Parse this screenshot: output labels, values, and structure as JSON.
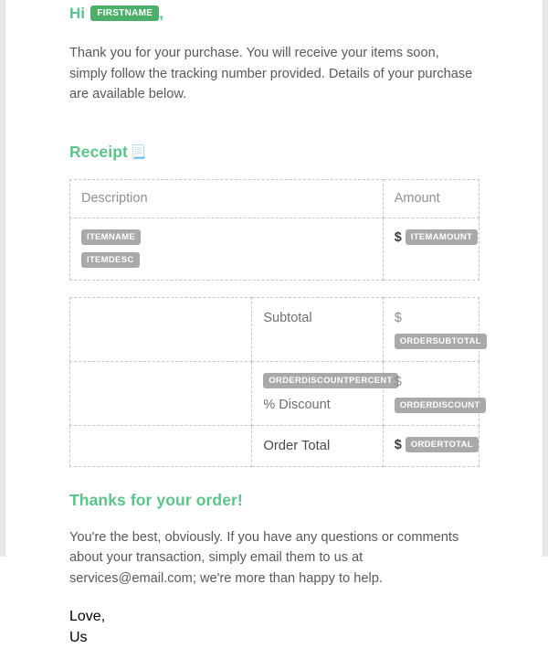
{
  "theme": {
    "accent_green": "#5bc48a",
    "tag_green": "#4caf69",
    "tag_gray": "#a9a9a9",
    "body_text": "#585858",
    "border_dashed": "#c6c6c6"
  },
  "greeting": {
    "salutation": "Hi",
    "name_tag": "FIRSTNAME",
    "comma": ","
  },
  "intro_paragraph": "Thank you for your purchase. You will receive your items soon, simply follow the tracking number provided. Details of your purchase are available below.",
  "receipt": {
    "heading": "Receipt",
    "heading_icon": "receipt-page-icon",
    "heading_icon_glyph": "📃",
    "columns": {
      "description": "Description",
      "amount": "Amount"
    },
    "item": {
      "name_tag": "ITEMNAME",
      "desc_tag": "ITEMDESC",
      "currency_symbol": "$",
      "amount_tag": "ITEMAMOUNT"
    }
  },
  "totals": {
    "rows": [
      {
        "label": "Subtotal",
        "label_tag": null,
        "currency_symbol": "$",
        "value_tag": "ORDERSUBTOTAL",
        "bold_currency": false,
        "inline": false
      },
      {
        "label": "% Discount",
        "label_tag": "ORDERDISCOUNTPERCENT",
        "currency_symbol": "$",
        "value_tag": "ORDERDISCOUNT",
        "bold_currency": false,
        "inline": false
      },
      {
        "label": "Order Total",
        "label_tag": null,
        "currency_symbol": "$",
        "value_tag": "ORDERTOTAL",
        "bold_currency": true,
        "inline": true
      }
    ]
  },
  "closing": {
    "heading": "Thanks for your order!",
    "paragraph": "You're the best, obviously. If you have any questions or comments about your transaction, simply email them to us at services@email.com; we're more than happy to help.",
    "signoff_line1": "Love,",
    "signoff_line2": "Us"
  }
}
